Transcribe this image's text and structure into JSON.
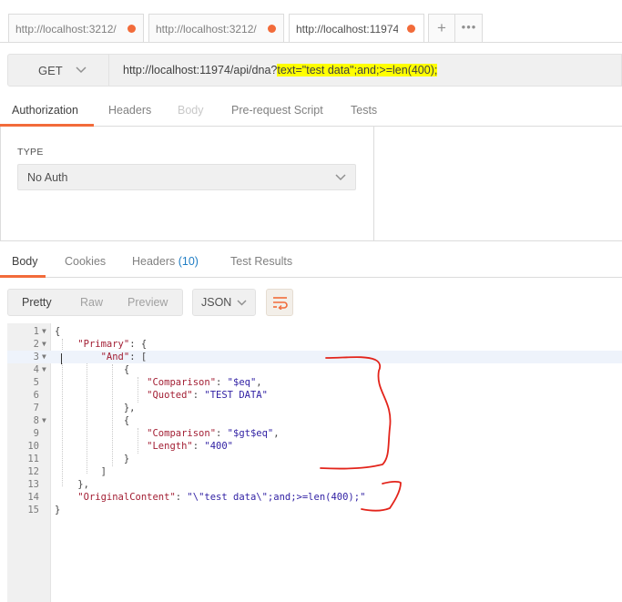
{
  "request_tabs": [
    {
      "label": "http://localhost:3212/",
      "dot_color": "#f26b3a"
    },
    {
      "label": "http://localhost:3212/",
      "dot_color": "#f26b3a"
    },
    {
      "label": "http://localhost:11974",
      "dot_color": "#f26b3a"
    }
  ],
  "tab_actions": {
    "add_glyph": "+",
    "more_glyph": "•••"
  },
  "request": {
    "method": "GET",
    "url_base": "http://localhost:11974/api/dna?",
    "url_query": "text=\"test data\";and;>=len(400);",
    "highlight_color": "#ffff00"
  },
  "request_subtabs": [
    "Authorization",
    "Headers",
    "Body",
    "Pre-request Script",
    "Tests"
  ],
  "auth": {
    "type_label": "TYPE",
    "type_value": "No Auth"
  },
  "response_tabs": {
    "body": "Body",
    "cookies": "Cookies",
    "headers": "Headers",
    "headers_count": "(10)",
    "tests": "Test Results"
  },
  "response_toolbar": {
    "pretty": "Pretty",
    "raw": "Raw",
    "preview": "Preview",
    "format": "JSON",
    "wrap_icon": "wrap-lines-icon"
  },
  "code_lines": [
    {
      "num": "1",
      "text": "{"
    },
    {
      "num": "2",
      "text": "    \"Primary\": {"
    },
    {
      "num": "3",
      "text": "        \"And\": ["
    },
    {
      "num": "4",
      "text": "            {"
    },
    {
      "num": "5",
      "text": "                \"Comparison\": \"$eq\","
    },
    {
      "num": "6",
      "text": "                \"Quoted\": \"TEST DATA\""
    },
    {
      "num": "7",
      "text": "            },"
    },
    {
      "num": "8",
      "text": "            {"
    },
    {
      "num": "9",
      "text": "                \"Comparison\": \"$gt$eq\","
    },
    {
      "num": "10",
      "text": "                \"Length\": \"400\""
    },
    {
      "num": "11",
      "text": "            }"
    },
    {
      "num": "12",
      "text": "        ]"
    },
    {
      "num": "13",
      "text": "    },"
    },
    {
      "num": "14",
      "text": "    \"OriginalContent\": \"\\\"test data\\\";and;>=len(400);\""
    },
    {
      "num": "15",
      "text": "}"
    }
  ],
  "annotation_color": "#e3241b",
  "accent_color": "#f26b3a"
}
